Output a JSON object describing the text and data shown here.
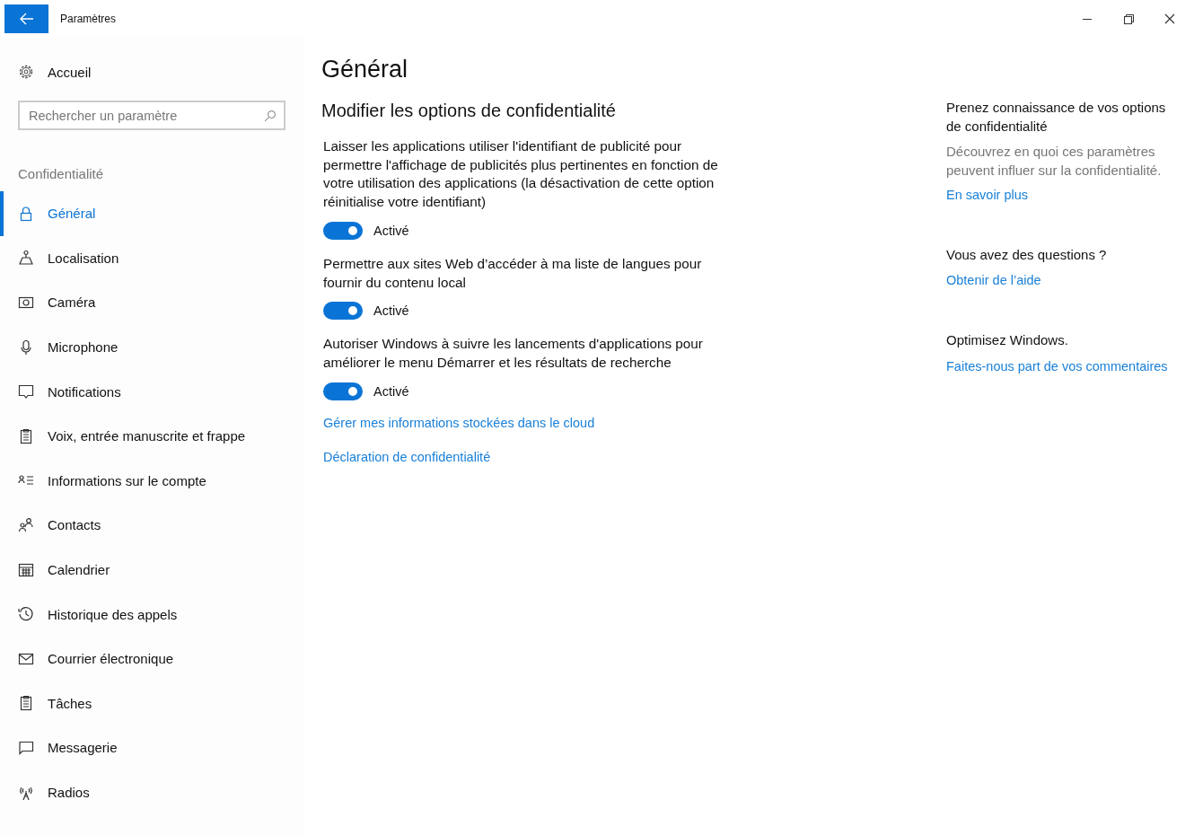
{
  "window": {
    "title": "Paramètres"
  },
  "sidebar": {
    "home": "Accueil",
    "search": {
      "placeholder": "Rechercher un paramètre"
    },
    "section": "Confidentialité",
    "items": [
      {
        "label": "Général",
        "selected": true
      },
      {
        "label": "Localisation",
        "selected": false
      },
      {
        "label": "Caméra",
        "selected": false
      },
      {
        "label": "Microphone",
        "selected": false
      },
      {
        "label": "Notifications",
        "selected": false
      },
      {
        "label": "Voix, entrée manuscrite et frappe",
        "selected": false
      },
      {
        "label": "Informations sur le compte",
        "selected": false
      },
      {
        "label": "Contacts",
        "selected": false
      },
      {
        "label": "Calendrier",
        "selected": false
      },
      {
        "label": "Historique des appels",
        "selected": false
      },
      {
        "label": "Courrier électronique",
        "selected": false
      },
      {
        "label": "Tâches",
        "selected": false
      },
      {
        "label": "Messagerie",
        "selected": false
      },
      {
        "label": "Radios",
        "selected": false
      }
    ]
  },
  "main": {
    "title": "Général",
    "subtitle": "Modifier les options de confidentialité",
    "options": [
      {
        "text": "Laisser les applications utiliser l'identifiant de publicité pour permettre l'affichage de publicités plus pertinentes en fonction de votre utilisation des applications (la désactivation de cette option réinitialise votre identifiant)",
        "on": true,
        "state": "Activé"
      },
      {
        "text": "Permettre aux sites Web d’accéder à ma liste de langues pour fournir du contenu local",
        "on": true,
        "state": "Activé"
      },
      {
        "text": "Autoriser Windows à suivre les lancements d'applications pour améliorer le menu Démarrer et les résultats de recherche",
        "on": true,
        "state": "Activé"
      }
    ],
    "links": [
      "Gérer mes informations stockées dans le cloud",
      "Déclaration de confidentialité"
    ]
  },
  "aside": [
    {
      "heading": "Prenez connaissance de vos options de confidentialité",
      "text": "Découvrez en quoi ces paramètres peuvent influer sur la confidentialité.",
      "link": "En savoir plus"
    },
    {
      "heading": "Vous avez des questions ?",
      "link": "Obtenir de l’aide"
    },
    {
      "heading": "Optimisez Windows.",
      "link": "Faites-nous part de vos commentaires"
    }
  ]
}
